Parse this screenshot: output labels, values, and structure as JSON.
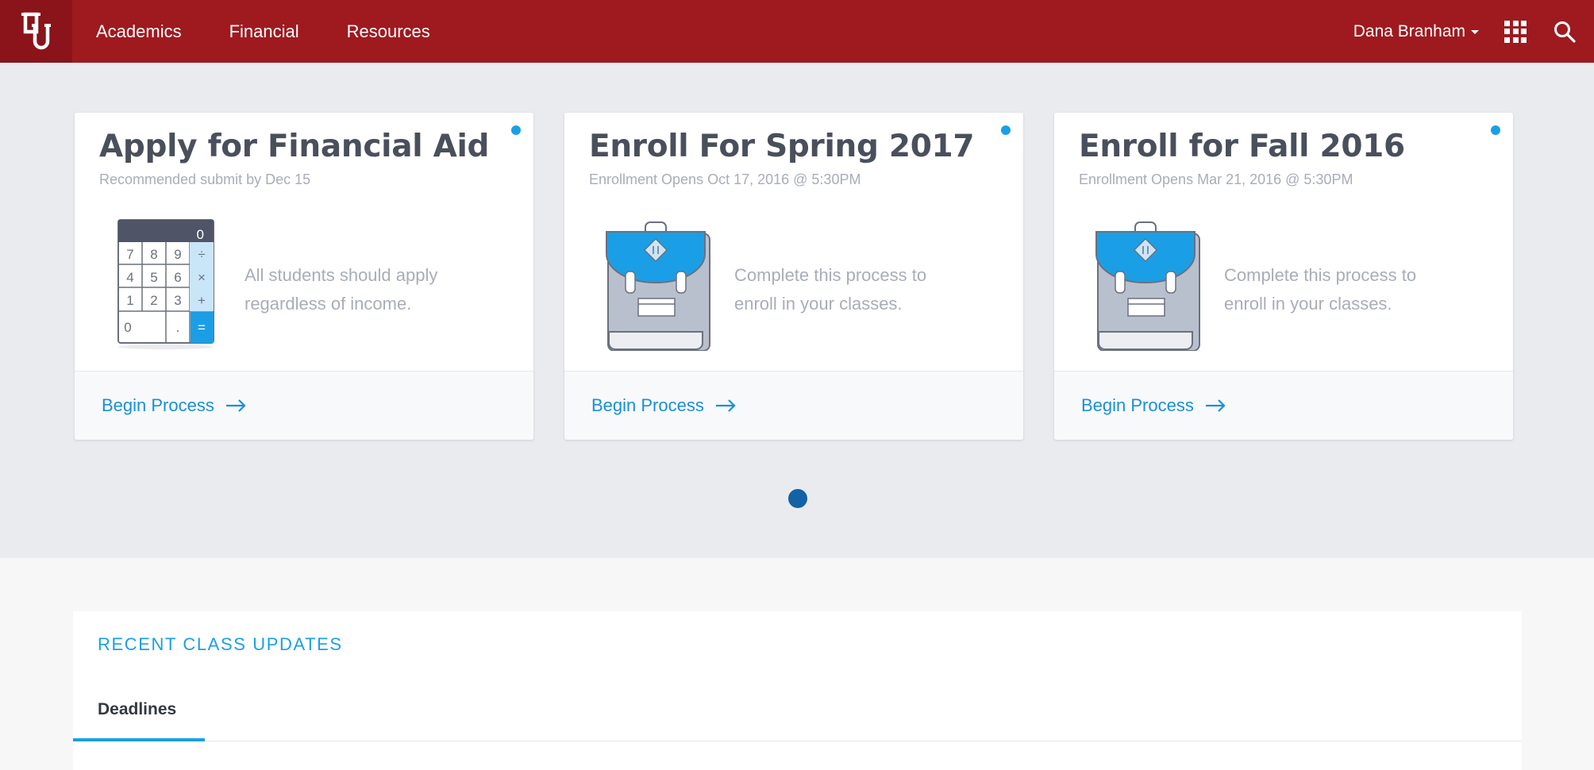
{
  "nav": {
    "items": [
      "Academics",
      "Financial",
      "Resources"
    ],
    "user_name": "Dana Branham"
  },
  "cards": [
    {
      "title": "Apply for Financial Aid",
      "subtitle": "Recommended submit by Dec 15",
      "description": "All students should apply regardless of income.",
      "action": "Begin Process",
      "illustration": "calculator-icon",
      "calculator": {
        "display": "0",
        "keys": [
          "7",
          "8",
          "9",
          "÷",
          "4",
          "5",
          "6",
          "×",
          "1",
          "2",
          "3",
          "+",
          "0",
          ".",
          "="
        ]
      }
    },
    {
      "title": "Enroll For Spring 2017",
      "subtitle": "Enrollment Opens Oct 17, 2016 @ 5:30PM",
      "description": "Complete this process to enroll in your classes.",
      "action": "Begin Process",
      "illustration": "backpack-icon"
    },
    {
      "title": "Enroll for Fall 2016",
      "subtitle": "Enrollment Opens Mar 21, 2016 @ 5:30PM",
      "description": "Complete this process to enroll in your classes.",
      "action": "Begin Process",
      "illustration": "backpack-icon"
    }
  ],
  "updates": {
    "title": "RECENT CLASS UPDATES",
    "active_tab": "Deadlines"
  },
  "colors": {
    "brand_red": "#9e1a1f",
    "accent_blue": "#1a9fe6",
    "pager_active": "#1162a6"
  }
}
